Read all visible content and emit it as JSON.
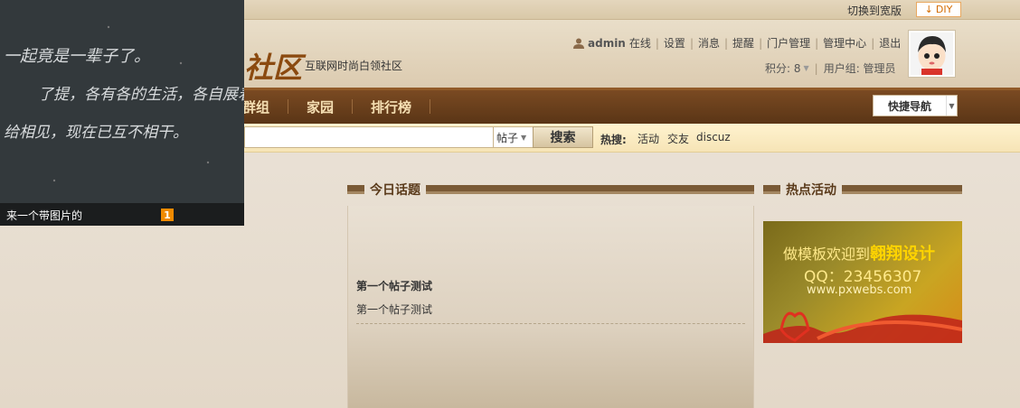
{
  "topbar": {
    "wide_link": "切换到宽版",
    "diy_label": "DIY"
  },
  "header": {
    "logo_text": "社区",
    "slogan": "互联网时尚白领社区",
    "user": {
      "name": "admin",
      "status": "在线",
      "links": [
        "设置",
        "消息",
        "提醒",
        "门户管理",
        "管理中心",
        "退出"
      ],
      "points": "积分: 8",
      "group": "用户组: 管理员"
    }
  },
  "nav": {
    "items": [
      "群组",
      "家园",
      "排行榜"
    ],
    "quick_nav": "快捷导航"
  },
  "search": {
    "type": "帖子",
    "button": "搜索",
    "hot_label": "热搜:",
    "hot_words": [
      "活动",
      "交友",
      "discuz"
    ]
  },
  "popup": {
    "caption": "来一个带图片的",
    "index": "1",
    "handwriting": [
      "一起竟是一辈子了。",
      "了提，各有各的生活，各自展着别再",
      "给相见，现在已互不相干。"
    ]
  },
  "today": {
    "title": "今日话题",
    "post_title": "第一个帖子测试",
    "post_body": "第一个帖子测试"
  },
  "events": {
    "title": "热点活动",
    "ad_line1_prefix": "做模板欢迎到",
    "ad_line1_brand": "翱翔设计",
    "ad_line2": "QQ：23456307",
    "ad_line3": "www.pxwebs.com"
  },
  "colors": {
    "nav_bg": "#5a3516",
    "accent": "#f08a00",
    "heading": "#5a3a1a"
  }
}
